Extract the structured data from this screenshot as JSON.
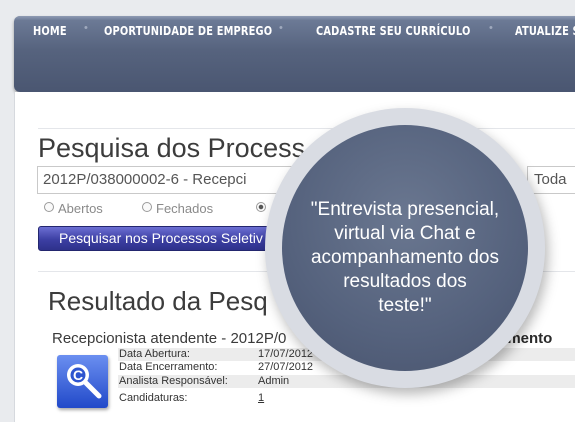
{
  "nav": {
    "items": [
      "HOME",
      "OPORTUNIDADE DE EMPREGO",
      "CADASTRE SEU CURRÍCULO",
      "ATUALIZE S"
    ]
  },
  "search": {
    "title": "Pesquisa dos Process",
    "query": "2012P/038000002-6 - Recepci",
    "select_value": "Toda",
    "radios": [
      "Abertos",
      "Fechados"
    ],
    "button_label": "Pesquisar nos Processos Seletiv"
  },
  "results": {
    "title": "Resultado da Pesq",
    "item_title": "Recepcionista atendente  -  2012P/0",
    "item_title_right": "tamento",
    "details": [
      {
        "label": "Data Abertura:",
        "value": "17/07/2012"
      },
      {
        "label": "Data Encerramento:",
        "value": "27/07/2012"
      },
      {
        "label": "Analista Responsável:",
        "value": "Admin"
      },
      {
        "label": "Candidaturas:",
        "value": "1"
      }
    ]
  },
  "callout": {
    "lines": [
      "\"Entrevista presencial,",
      "virtual via Chat e",
      "acompanhamento dos",
      "resultados dos",
      "teste!\""
    ]
  },
  "colors": {
    "nav": "#56637e",
    "button": "#3c3fa3",
    "bubble": "#55627d"
  }
}
